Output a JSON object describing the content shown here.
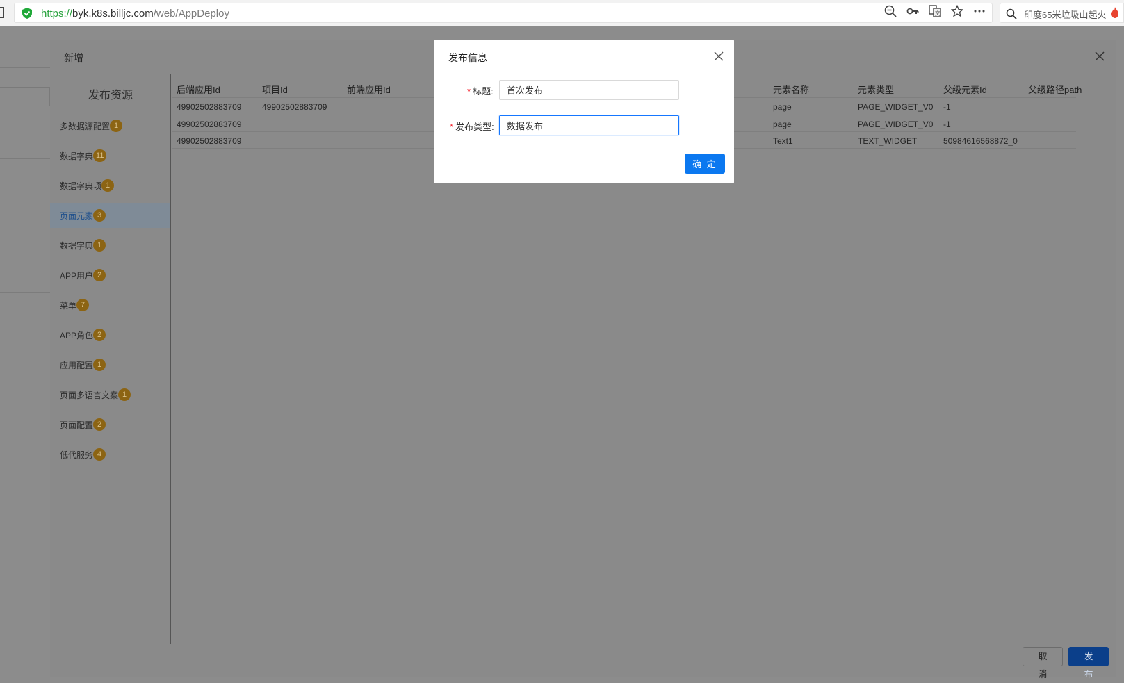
{
  "browser": {
    "url_scheme": "https://",
    "url_host": "byk.k8s.billjc.com",
    "url_path": "/web/AppDeploy",
    "search_query": "印度65米垃圾山起火"
  },
  "outer_modal": {
    "title": "新增",
    "sidebar_title": "发布资源",
    "sidebar_items": [
      {
        "label": "多数据源配置",
        "count": "1"
      },
      {
        "label": "数据字典",
        "count": "11"
      },
      {
        "label": "数据字典项",
        "count": "1"
      },
      {
        "label": "页面元素",
        "count": "3"
      },
      {
        "label": "数据字典",
        "count": "1"
      },
      {
        "label": "APP用户",
        "count": "2"
      },
      {
        "label": "菜单",
        "count": "7"
      },
      {
        "label": "APP角色",
        "count": "2"
      },
      {
        "label": "应用配置",
        "count": "1"
      },
      {
        "label": "页面多语言文案",
        "count": "1"
      },
      {
        "label": "页面配置",
        "count": "2"
      },
      {
        "label": "低代服务",
        "count": "4"
      }
    ],
    "table": {
      "headers": [
        "后端应用Id",
        "项目Id",
        "前端应用Id",
        "元素名称",
        "元素类型",
        "父级元素Id",
        "父级路径path"
      ],
      "rows": [
        [
          "49902502883709",
          "49902502883709",
          "",
          "page",
          "PAGE_WIDGET_V0",
          "-1",
          ""
        ],
        [
          "49902502883709",
          "",
          "",
          "page",
          "PAGE_WIDGET_V0",
          "-1",
          ""
        ],
        [
          "49902502883709",
          "",
          "",
          "Text1",
          "TEXT_WIDGET",
          "50984616568872_0",
          ""
        ]
      ]
    },
    "cancel_label": "取 消",
    "publish_label": "发 布"
  },
  "dialog": {
    "title": "发布信息",
    "title_field_label": "标题:",
    "title_field_value": "首次发布",
    "type_field_label": "发布类型:",
    "type_field_value": "数据发布",
    "ok_label": "确 定"
  },
  "colors": {
    "primary": "#0b78f0",
    "badge": "#8c6413",
    "required": "#f5222d"
  }
}
